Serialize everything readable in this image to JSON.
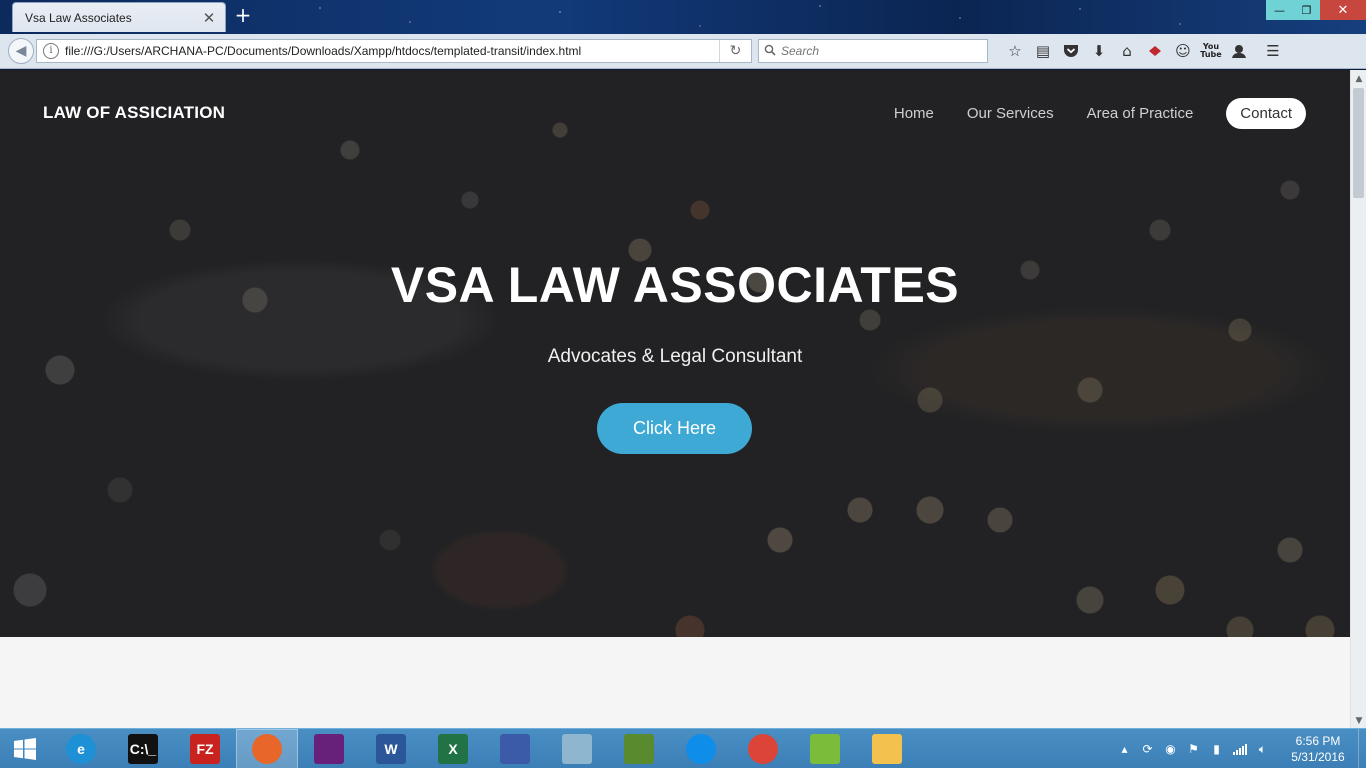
{
  "browser": {
    "tab_title": "Vsa Law Associates",
    "tab_close": "✕",
    "new_tab": "+",
    "url": "file:///G:/Users/ARCHANA-PC/Documents/Downloads/Xampp/htdocs/templated-transit/index.html",
    "search_placeholder": "Search",
    "window_controls": {
      "minimize": "—",
      "maximize": "❐",
      "close": "✕"
    },
    "toolbar_icons": [
      "bookmark-star-icon",
      "reading-list-icon",
      "pocket-icon",
      "download-icon",
      "home-icon",
      "extension-icon",
      "emoji-icon",
      "youtube-icon",
      "account-icon",
      "menu-icon"
    ],
    "youtube_label_top": "You",
    "youtube_label_bottom": "Tube"
  },
  "site": {
    "logo": "LAW OF ASSICIATION",
    "nav": {
      "home": "Home",
      "services": "Our Services",
      "practice": "Area of Practice",
      "contact": "Contact"
    },
    "hero": {
      "title": "VSA LAW ASSOCIATES",
      "subtitle": "Advocates & Legal Consultant",
      "button": "Click Here"
    },
    "accent_color": "#3fa9d6"
  },
  "taskbar": {
    "apps": [
      {
        "name": "internet-explorer",
        "label": "e",
        "color": "#1e90d6"
      },
      {
        "name": "command-prompt",
        "label": "C:\\_",
        "color": "#111111"
      },
      {
        "name": "filezilla",
        "label": "FZ",
        "color": "#c8231e"
      },
      {
        "name": "firefox",
        "label": "",
        "color": "#e8662a"
      },
      {
        "name": "visual-studio",
        "label": "",
        "color": "#68217a"
      },
      {
        "name": "word",
        "label": "W",
        "color": "#2b579a"
      },
      {
        "name": "excel",
        "label": "X",
        "color": "#217346"
      },
      {
        "name": "app-blue-doc",
        "label": "",
        "color": "#3b5ba8"
      },
      {
        "name": "app-notes",
        "label": "",
        "color": "#8fb6cf"
      },
      {
        "name": "app-editor",
        "label": "",
        "color": "#5a8a2e"
      },
      {
        "name": "teamviewer",
        "label": "",
        "color": "#0e8ee9"
      },
      {
        "name": "chrome",
        "label": "",
        "color": "#db4437"
      },
      {
        "name": "bluestacks",
        "label": "",
        "color": "#7bbd3a"
      },
      {
        "name": "file-explorer",
        "label": "",
        "color": "#f2c14e"
      }
    ],
    "active_app": "firefox",
    "clock_time": "6:56 PM",
    "clock_date": "5/31/2016"
  }
}
